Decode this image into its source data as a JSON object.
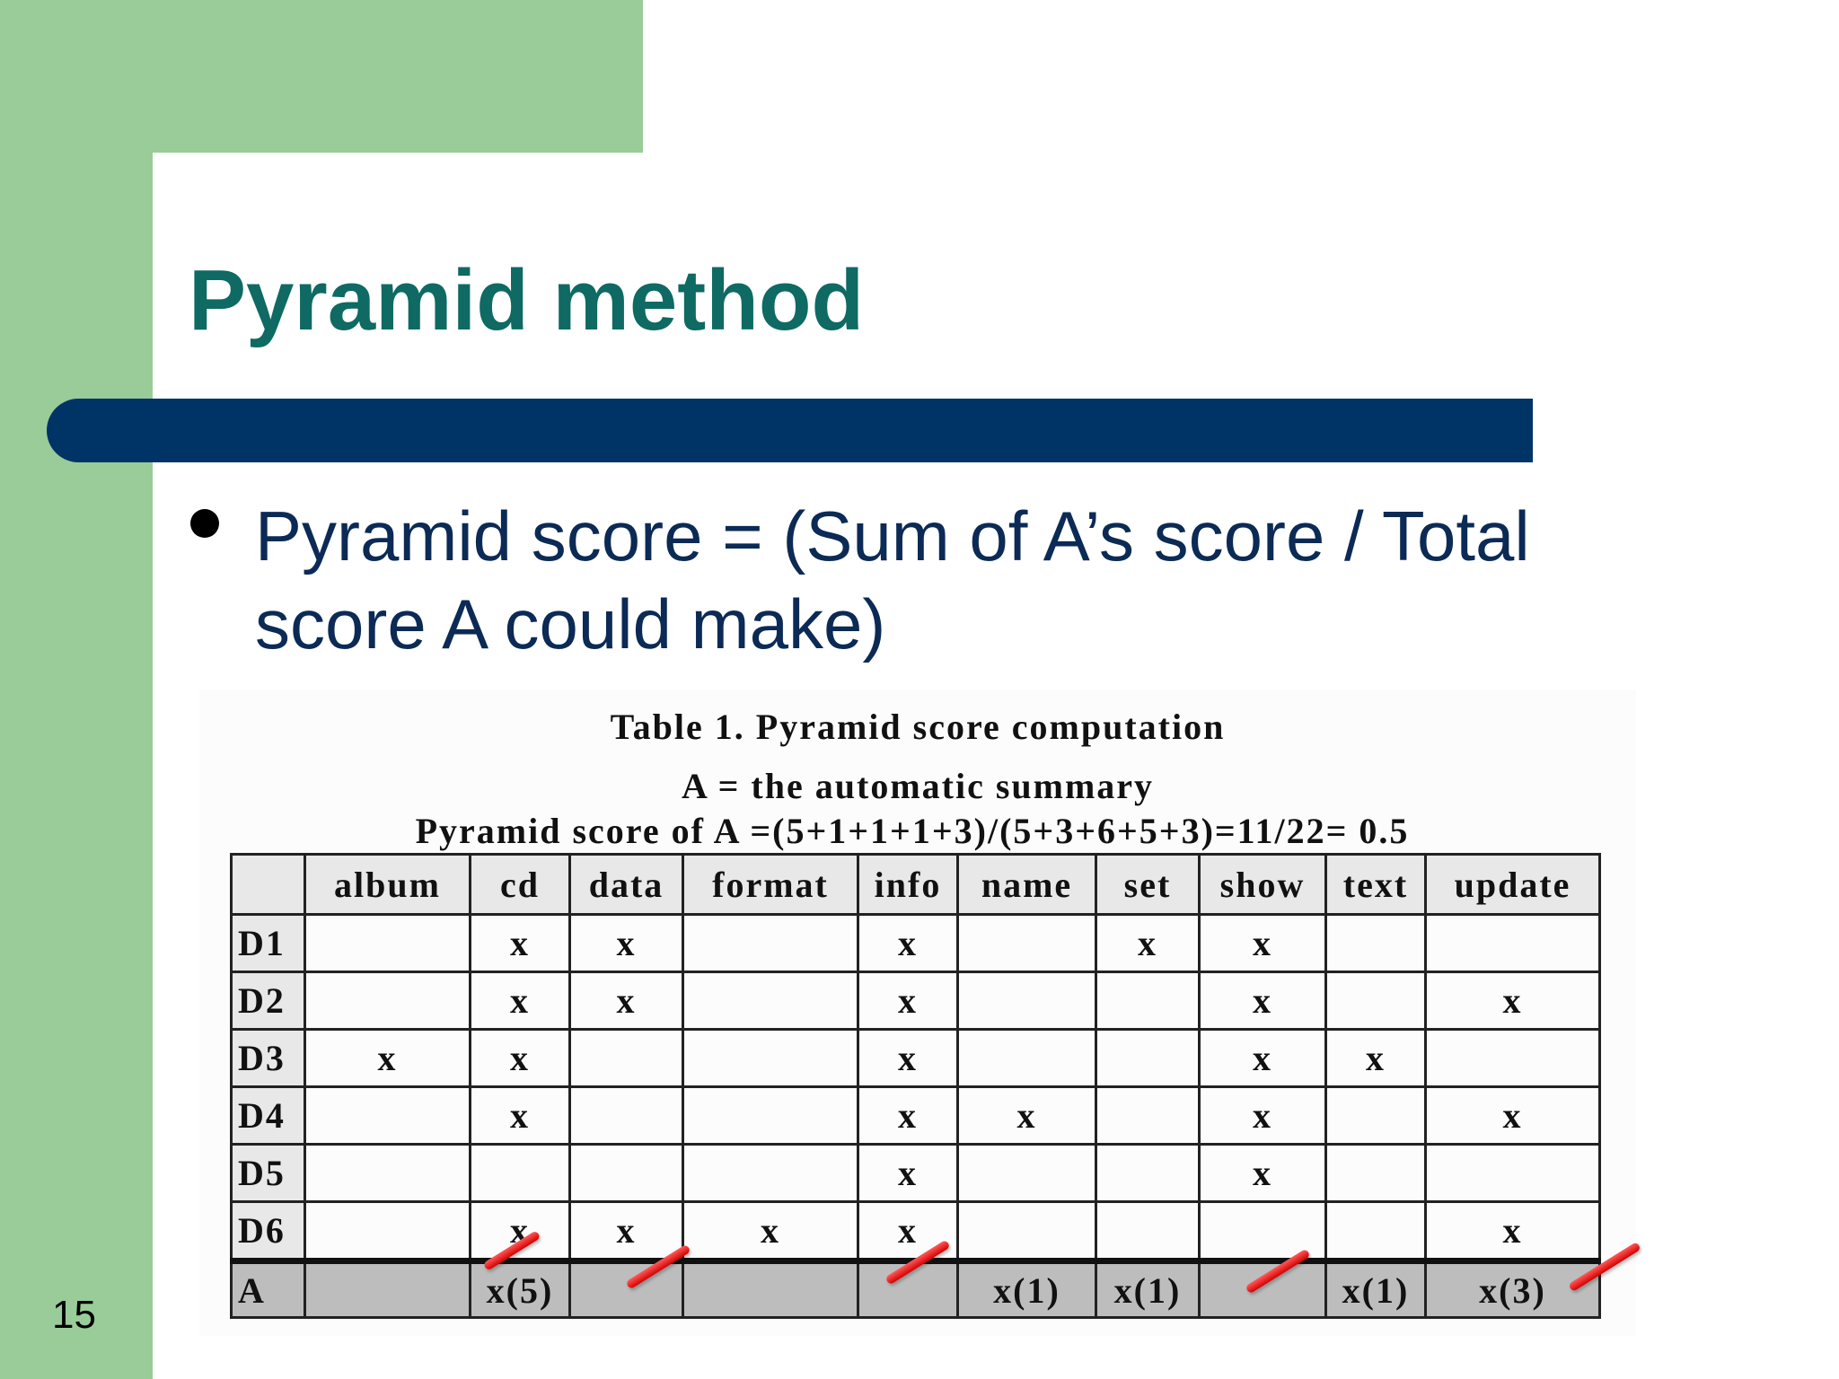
{
  "slide": {
    "title": "Pyramid method",
    "bullet": "Pyramid score = (Sum of A’s score / Total score A could make)",
    "page_number": "15"
  },
  "table": {
    "caption": "Table 1. Pyramid score computation",
    "subcaption": "A = the automatic summary",
    "formula": "Pyramid score of A =(5+1+1+1+3)/(5+3+6+5+3)=11/22= 0.5",
    "columns": [
      "",
      "album",
      "cd",
      "data",
      "format",
      "info",
      "name",
      "set",
      "show",
      "text",
      "update"
    ],
    "rows": [
      {
        "label": "D1",
        "cells": [
          "",
          "x",
          "x",
          "",
          "x",
          "",
          "x",
          "x",
          "",
          ""
        ]
      },
      {
        "label": "D2",
        "cells": [
          "",
          "x",
          "x",
          "",
          "x",
          "",
          "",
          "x",
          "",
          "x"
        ]
      },
      {
        "label": "D3",
        "cells": [
          "x",
          "x",
          "",
          "",
          "x",
          "",
          "",
          "x",
          "x",
          ""
        ]
      },
      {
        "label": "D4",
        "cells": [
          "",
          "x",
          "",
          "",
          "x",
          "x",
          "",
          "x",
          "",
          "x"
        ]
      },
      {
        "label": "D5",
        "cells": [
          "",
          "",
          "",
          "",
          "x",
          "",
          "",
          "x",
          "",
          ""
        ]
      },
      {
        "label": "D6",
        "cells": [
          "",
          "x",
          "x",
          "x",
          "x",
          "",
          "",
          "",
          "",
          "x"
        ]
      }
    ],
    "total_row": {
      "label": "A",
      "cells": [
        "",
        "x(5)",
        "",
        "",
        "",
        "x(1)",
        "x(1)",
        "",
        "x(1)",
        "x(3)"
      ]
    }
  },
  "colors": {
    "sidebar_green": "#99cc99",
    "title_teal": "#0e6a63",
    "bar_navy": "#003366",
    "slash_red": "#d40000"
  }
}
